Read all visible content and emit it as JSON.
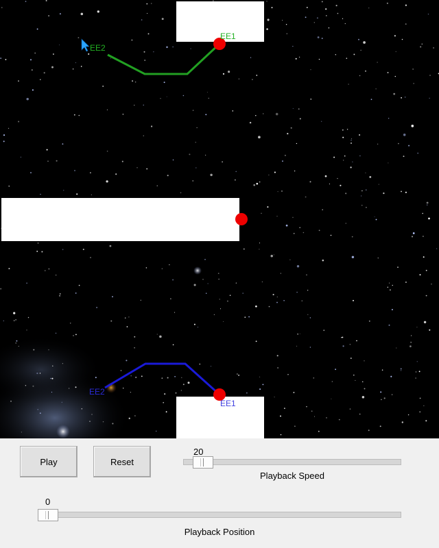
{
  "scene": {
    "labels": {
      "top_ee1": "EE1",
      "top_ee2": "EE2",
      "bottom_ee1": "EE1",
      "bottom_ee2": "EE2"
    },
    "colors": {
      "background": "#000000",
      "walls": "#ffffff",
      "top_arm": "#22a022",
      "bottom_arm": "#1a1ad8",
      "target": "#ee0000",
      "top_label": "#22b022",
      "bottom_label": "#4040e0",
      "cursor": "#2aa4ff"
    }
  },
  "controls": {
    "play_label": "Play",
    "reset_label": "Reset",
    "speed": {
      "value": "20",
      "label": "Playback Speed",
      "fraction": 0.05
    },
    "position": {
      "value": "0",
      "label": "Playback Position",
      "fraction": 0.0
    }
  }
}
